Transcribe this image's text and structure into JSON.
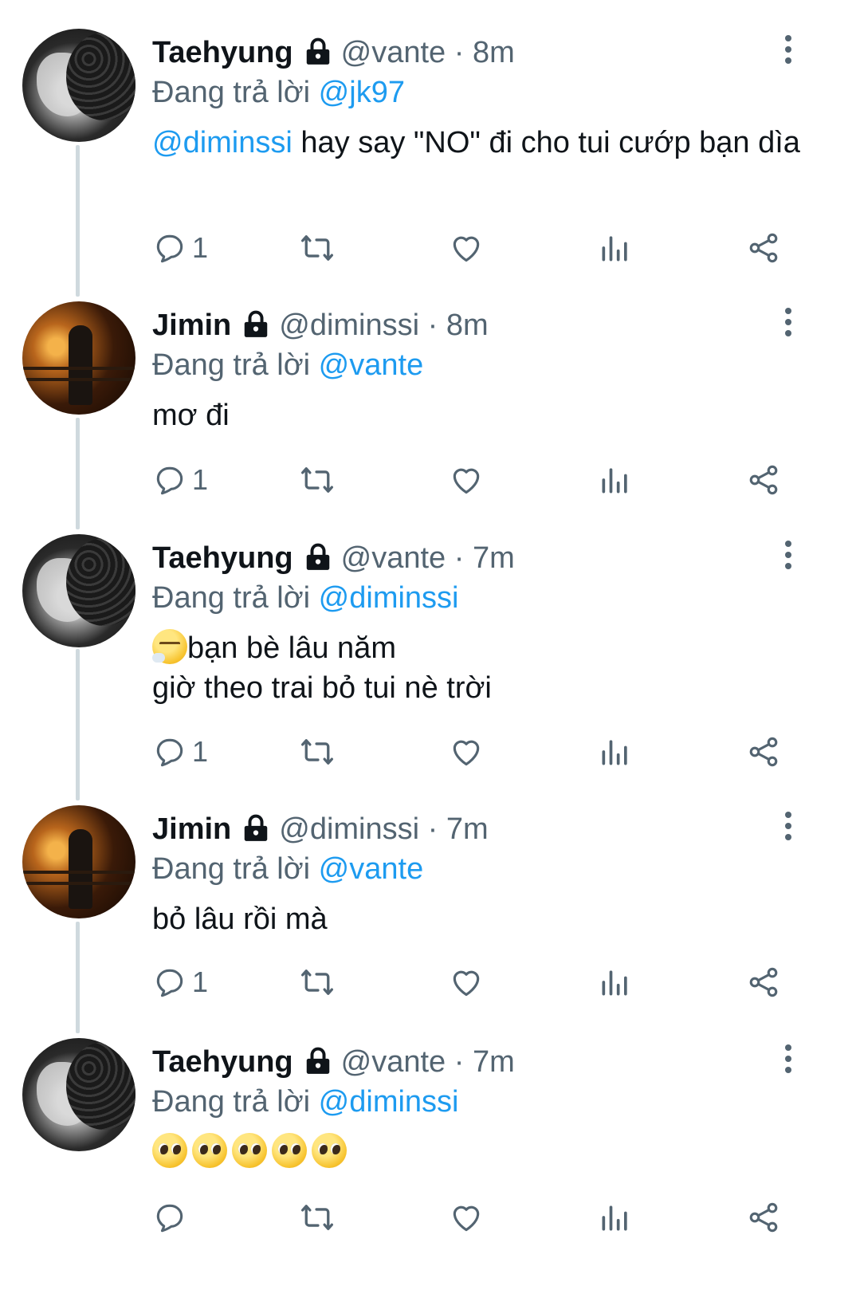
{
  "icons": {
    "more": "more-vertical-icon",
    "lock": "lock-icon",
    "reply": "reply-icon",
    "retweet": "retweet-icon",
    "like": "heart-icon",
    "views": "analytics-icon",
    "share": "share-icon"
  },
  "colors": {
    "accent": "#1d9bf0",
    "muted": "#536471",
    "thread_line": "#cfd9de"
  },
  "tweets": [
    {
      "name": "Taehyung",
      "handle": "@vante",
      "time": "· 8m",
      "reply_prefix": "Đang trả lời",
      "reply_to": "@jk97",
      "mention": "@diminssi",
      "text": " hay say \"NO\" đi cho tui cướp bạn dìa",
      "reply_count": "1"
    },
    {
      "name": "Jimin",
      "handle": "@diminssi",
      "time": "· 8m",
      "reply_prefix": "Đang trả lời",
      "reply_to": "@vante",
      "text": "mơ đi",
      "reply_count": "1"
    },
    {
      "name": "Taehyung",
      "handle": "@vante",
      "time": "· 7m",
      "reply_prefix": "Đang trả lời",
      "reply_to": "@diminssi",
      "emoji": "😮‍💨",
      "line1": "bạn bè lâu năm",
      "line2": "giờ theo trai bỏ tui nè trời",
      "reply_count": "1"
    },
    {
      "name": "Jimin",
      "handle": "@diminssi",
      "time": "· 7m",
      "reply_prefix": "Đang trả lời",
      "reply_to": "@vante",
      "text": "bỏ lâu rồi mà",
      "reply_count": "1"
    },
    {
      "name": "Taehyung",
      "handle": "@vante",
      "time": "· 7m",
      "reply_prefix": "Đang trả lời",
      "reply_to": "@diminssi",
      "emojis": "🥺🥺🥺🥺🥺",
      "reply_count": ""
    }
  ]
}
